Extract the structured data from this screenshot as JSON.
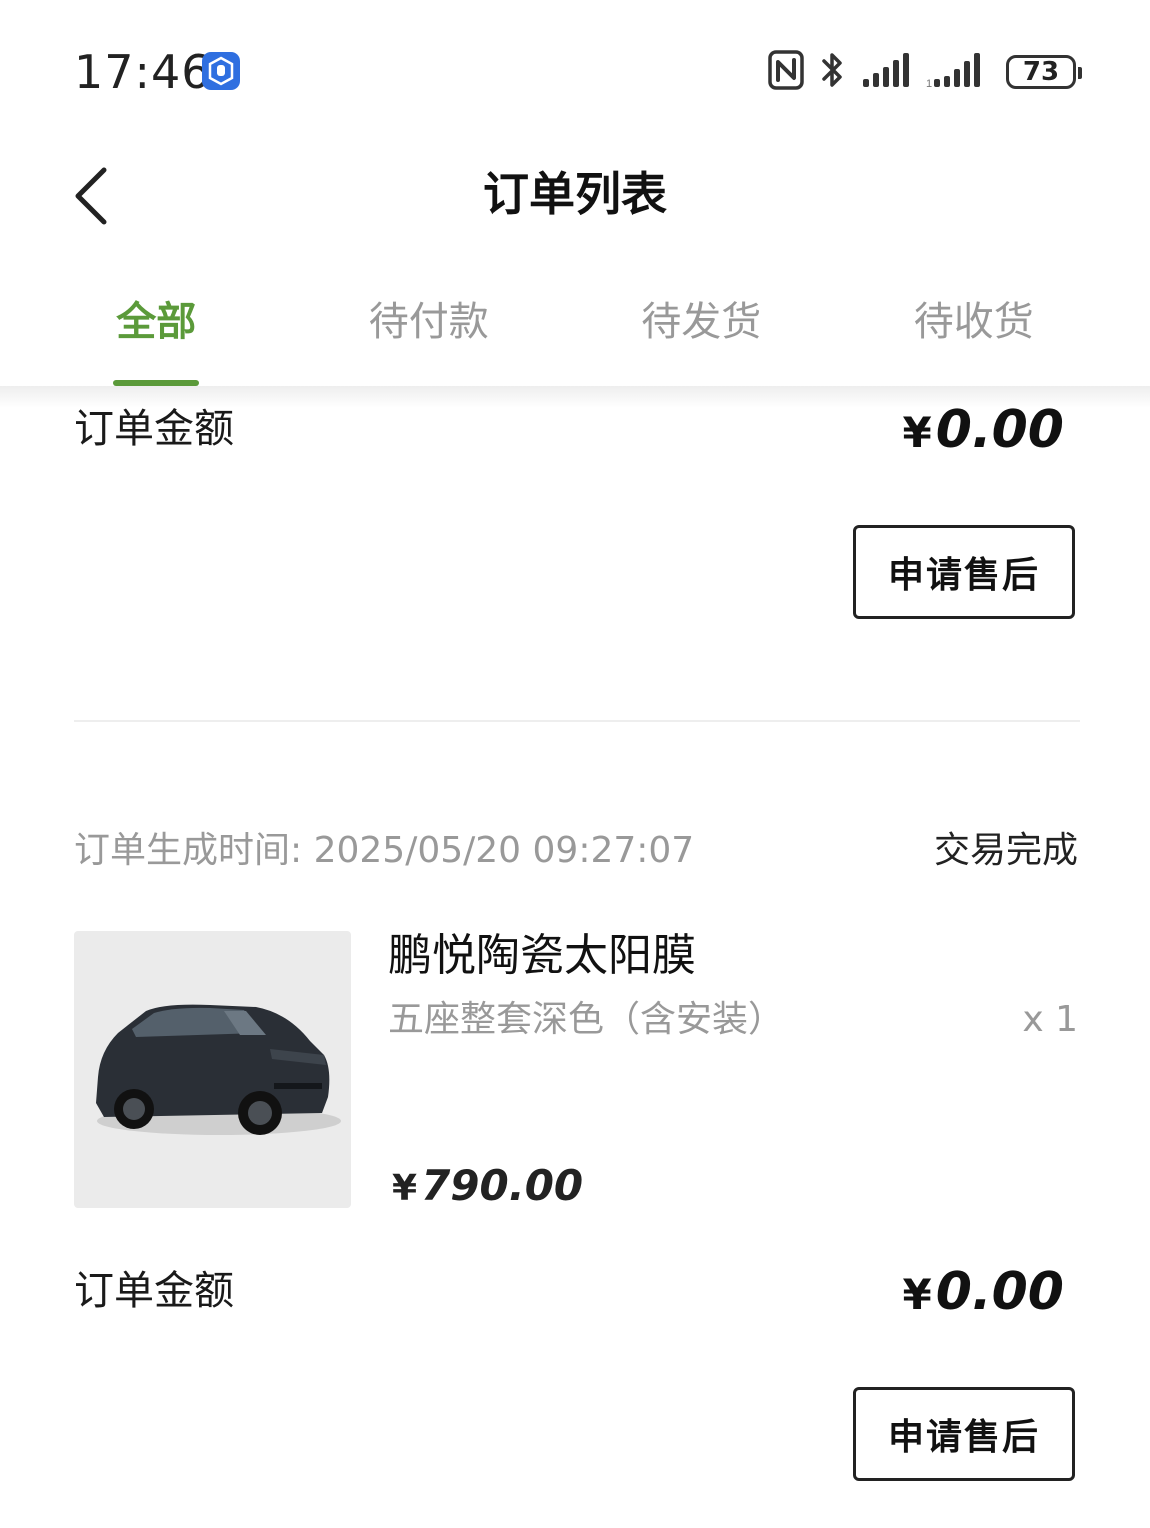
{
  "status_bar": {
    "time": "17:46",
    "battery": "73",
    "icons": [
      "hand-app-icon",
      "nfc-icon",
      "bluetooth-icon",
      "signal-icon",
      "signal-icon"
    ]
  },
  "nav": {
    "title": "订单列表"
  },
  "tabs": [
    {
      "label": "全部",
      "active": true
    },
    {
      "label": "待付款",
      "active": false
    },
    {
      "label": "待发货",
      "active": false
    },
    {
      "label": "待收货",
      "active": false
    }
  ],
  "orders": [
    {
      "amount_label": "订单金额",
      "amount_currency": "¥",
      "amount_value": "0.00",
      "action_label": "申请售后"
    },
    {
      "created_label": "订单生成时间:",
      "created_time": "2025/05/20 09:27:07",
      "status": "交易完成",
      "product_name": "鹏悦陶瓷太阳膜",
      "product_spec": "五座整套深色（含安装）",
      "quantity": "x 1",
      "price_currency": "¥",
      "price_value": "790.00",
      "amount_label": "订单金额",
      "amount_currency": "¥",
      "amount_value": "0.00",
      "action_label": "申请售后"
    }
  ],
  "colors": {
    "accent": "#5b9a3a",
    "muted_text": "#999999",
    "badge_blue": "#2f6fe0"
  }
}
